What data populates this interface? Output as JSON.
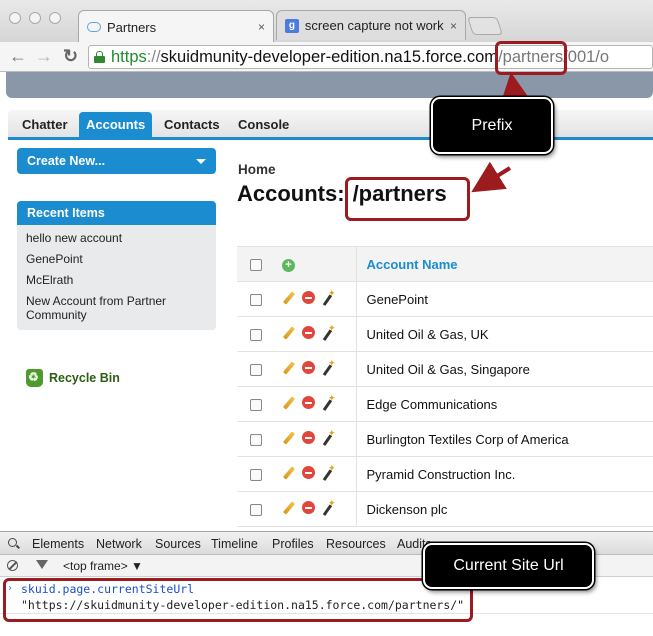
{
  "browser": {
    "tabs": [
      {
        "title": "Partners",
        "close": "×",
        "active": true
      },
      {
        "title": "screen capture not working",
        "close": "×",
        "active": false
      }
    ],
    "nav": {
      "back": "←",
      "forward": "→",
      "reload": "C"
    },
    "url": {
      "scheme": "https",
      "separator": "://",
      "host": "skuidmunity-developer-edition.na15.force.com",
      "path": "/partners",
      "rest": "/001/o"
    }
  },
  "salesforce": {
    "nav_tabs": [
      "Chatter",
      "Accounts",
      "Contacts",
      "Console"
    ],
    "active_tab": "Accounts",
    "sidebar": {
      "create_new_label": "Create New...",
      "recent_items_heading": "Recent Items",
      "recent_items": [
        "hello new account",
        "GenePoint",
        "McElrath",
        "New Account from Partner Community"
      ],
      "recycle_bin_label": "Recycle Bin"
    },
    "breadcrumb": "Home",
    "title_prefix": "Accounts:",
    "title_path": "/partners",
    "table": {
      "column_header": "Account Name",
      "rows": [
        "GenePoint",
        "United Oil & Gas, UK",
        "United Oil & Gas, Singapore",
        "Edge Communications",
        "Burlington Textiles Corp of America",
        "Pyramid Construction Inc.",
        "Dickenson plc"
      ]
    }
  },
  "devtools": {
    "tabs": [
      "Elements",
      "Network",
      "Sources",
      "Timeline",
      "Profiles",
      "Resources",
      "Audits"
    ],
    "frame_selector": "<top frame> ▼",
    "console_input": "skuid.page.currentSiteUrl",
    "console_output": "\"https://skuidmunity-developer-edition.na15.force.com/partners/\""
  },
  "annotations": {
    "prefix_label": "Prefix",
    "current_site_url_label": "Current Site Url",
    "highlight_color": "#9b1b1f"
  }
}
